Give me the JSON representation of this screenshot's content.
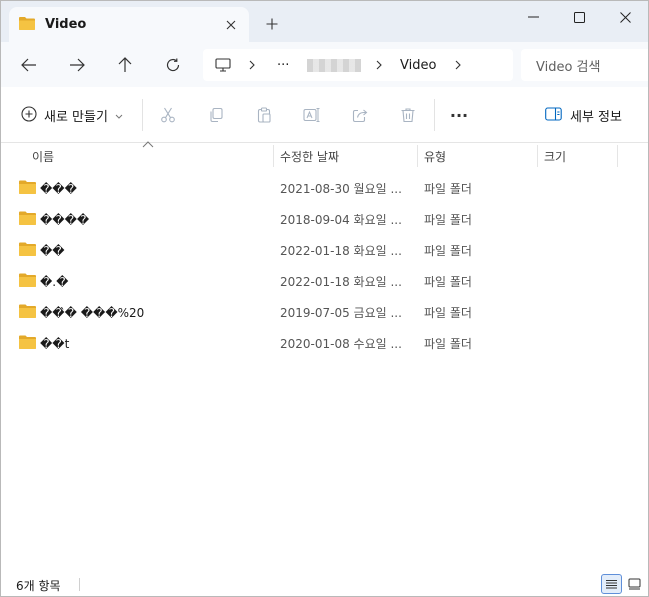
{
  "tab": {
    "title": "Video",
    "close_icon": "close-icon",
    "new_tab_icon": "plus-icon"
  },
  "window_controls": {
    "minimize": "minimize-icon",
    "maximize": "maximize-icon",
    "close": "close-icon"
  },
  "nav": {
    "back": "arrow-left-icon",
    "forward": "arrow-right-icon",
    "up": "arrow-up-icon",
    "refresh": "refresh-icon",
    "address": {
      "root_icon": "computer-icon",
      "overflow": "···",
      "blurred_segment": "",
      "current": "Video"
    },
    "search_placeholder": "Video 검색"
  },
  "toolbar": {
    "new_label": "새로 만들기",
    "cut": "scissors-icon",
    "copy": "copy-icon",
    "paste": "paste-icon",
    "rename": "rename-icon",
    "share": "share-icon",
    "delete": "trash-icon",
    "more": "···",
    "details_label": "세부 정보"
  },
  "columns": {
    "name": "이름",
    "modified": "수정한 날짜",
    "type": "유형",
    "size": "크기"
  },
  "files": [
    {
      "name": "���",
      "modified": "2021-08-30 월요일 ...",
      "type": "파일 폴더"
    },
    {
      "name": "����",
      "modified": "2018-09-04 화요일 ...",
      "type": "파일 폴더"
    },
    {
      "name": "��",
      "modified": "2022-01-18 화요일 ...",
      "type": "파일 폴더"
    },
    {
      "name": "�.�",
      "modified": "2022-01-18 화요일 ...",
      "type": "파일 폴더"
    },
    {
      "name": "��̂� ���%20",
      "modified": "2019-07-05 금요일 ...",
      "type": "파일 폴더"
    },
    {
      "name": "��t",
      "modified": "2020-01-08 수요일 ...",
      "type": "파일 폴더"
    }
  ],
  "status": {
    "count": "6개 항목"
  },
  "colors": {
    "folder": "#f5c342",
    "folder_dark": "#e3a92a",
    "accent": "#0067c0",
    "chrome": "#e9eef5"
  }
}
